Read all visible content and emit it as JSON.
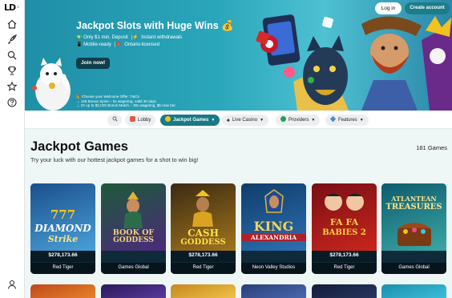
{
  "brand": {
    "logo_text": "LD",
    "collapse_glyph": "›"
  },
  "sidebar": {
    "icons": [
      "home-icon",
      "rocket-icon",
      "search-icon",
      "trophy-icon",
      "star-icon",
      "help-icon",
      "user-icon"
    ]
  },
  "hero": {
    "title": "Jackpot Slots with Huge Wins 💰",
    "bullets": [
      {
        "text": "Only $1 min. Deposit",
        "sep": "Instant withdrawals"
      },
      {
        "text": "Mobile-ready",
        "sep": "Ontario-licensed"
      }
    ],
    "join_label": "Join now!",
    "fine_print": [
      "🎁 Choose your Welcome Offer: T&Cs",
      "→ 125 Bonus Spins – 0x wagering, valid 30 days",
      "→ Or up to $2,025 Bonus Match – 30x wagering, $5 max bet"
    ]
  },
  "header": {
    "login_label": "Log in",
    "create_label": "Create account"
  },
  "nav": {
    "chips": [
      {
        "label": "",
        "icon": "search-icon"
      },
      {
        "label": "Lobby",
        "icon": "lobby-icon"
      },
      {
        "label": "Jackpot Games",
        "icon": "jackpot-icon",
        "active": true
      },
      {
        "label": "Live Casino",
        "icon": "spade-icon"
      },
      {
        "label": "Providers",
        "icon": "providers-icon"
      },
      {
        "label": "Features",
        "icon": "features-icon"
      }
    ]
  },
  "main": {
    "title": "Jackpot Games",
    "count": "181 Games",
    "subtitle": "Try your luck with our hottest jackpot games for a shot to win big!"
  },
  "games": [
    {
      "title_lines": [
        "777",
        "DIAMOND",
        "Strike"
      ],
      "jackpot": "$278,173.66",
      "provider": "Red Tiger",
      "colors": [
        "#1b4f8c",
        "#49a0d8"
      ]
    },
    {
      "title_lines": [
        "BOOK OF",
        "GODDESS"
      ],
      "jackpot": "",
      "provider": "Games Global",
      "colors": [
        "#1d5a3a",
        "#4b2a7a"
      ]
    },
    {
      "title_lines": [
        "CASH",
        "GODDESS"
      ],
      "jackpot": "$278,173.66",
      "provider": "Red Tiger",
      "colors": [
        "#3b2a12",
        "#a0741c"
      ]
    },
    {
      "title_lines": [
        "KING",
        "ALEXANDRIA"
      ],
      "jackpot": "",
      "provider": "Neon Valley Studios",
      "colors": [
        "#0f3d6b",
        "#2d6fb2"
      ]
    },
    {
      "title_lines": [
        "FA FA",
        "BABIES 2"
      ],
      "jackpot": "$278,173.66",
      "provider": "Red Tiger",
      "colors": [
        "#7a0f14",
        "#c9261d"
      ]
    },
    {
      "title_lines": [
        "ATLANTEAN",
        "TREASURES"
      ],
      "jackpot": "",
      "provider": "Games Global",
      "colors": [
        "#0c5c6e",
        "#3ca6a4"
      ]
    }
  ],
  "next_row_colors": [
    "#c04a1c",
    "#2a1b5a",
    "#c7881e",
    "#2a3f7a",
    "#121c3a",
    "#1c8fb0"
  ]
}
